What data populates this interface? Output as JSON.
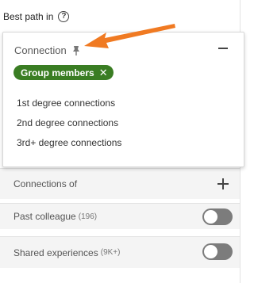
{
  "header": {
    "label": "Best path in",
    "help_glyph": "?"
  },
  "connection_filter": {
    "title": "Connection",
    "selected_chip": {
      "label": "Group members",
      "close_glyph": "✕",
      "color": "#3a7d23"
    },
    "options": [
      {
        "label": "1st degree connections"
      },
      {
        "label": "2nd degree connections"
      },
      {
        "label": "3rd+ degree connections"
      }
    ]
  },
  "rows": [
    {
      "label": "Connections of",
      "count": "",
      "control": "plus"
    },
    {
      "label": "Past colleague",
      "count": "(196)",
      "control": "toggle",
      "on": false
    },
    {
      "label": "Shared experiences",
      "count": "(9K+)",
      "control": "toggle",
      "on": false
    }
  ],
  "annotation": {
    "arrow_color": "#f07a22"
  }
}
